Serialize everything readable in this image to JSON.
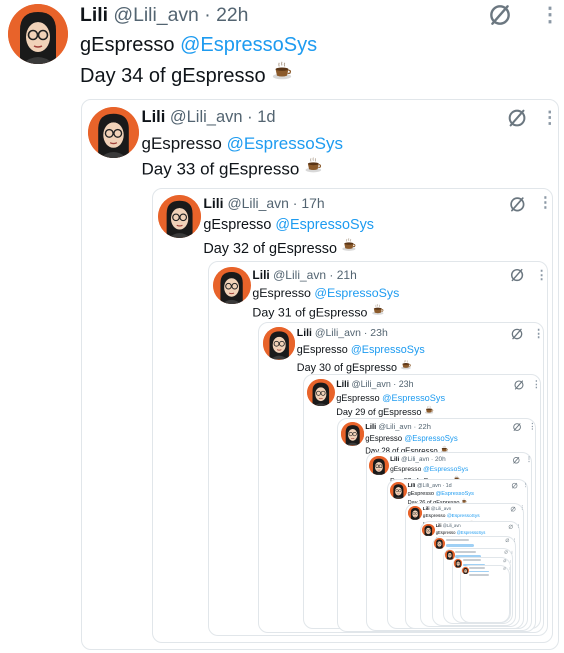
{
  "accent_color": "#1d9bf0",
  "avatar_colors": {
    "background": "#e8632a",
    "hair": "#1a1a1a",
    "skin": "#f1d2b8"
  },
  "tweets": [
    {
      "name": "Lili",
      "handle": "@Lili_avn",
      "time": "22h",
      "text": "gEspresso",
      "mention": "@EspressoSys",
      "caption": "Day 34 of gEspresso"
    },
    {
      "name": "Lili",
      "handle": "@Lili_avn",
      "time": "1d",
      "text": "gEspresso",
      "mention": "@EspressoSys",
      "caption": "Day 33 of gEspresso"
    },
    {
      "name": "Lili",
      "handle": "@Lili_avn",
      "time": "17h",
      "text": "gEspresso",
      "mention": "@EspressoSys",
      "caption": "Day 32 of gEspresso"
    },
    {
      "name": "Lili",
      "handle": "@Lili_avn",
      "time": "21h",
      "text": "gEspresso",
      "mention": "@EspressoSys",
      "caption": "Day 31 of gEspresso"
    },
    {
      "name": "Lili",
      "handle": "@Lili_avn",
      "time": "23h",
      "text": "gEspresso",
      "mention": "@EspressoSys",
      "caption": "Day 30 of gEspresso"
    },
    {
      "name": "Lili",
      "handle": "@Lili_avn",
      "time": "23h",
      "text": "gEspresso",
      "mention": "@EspressoSys",
      "caption": "Day 29 of gEspresso"
    },
    {
      "name": "Lili",
      "handle": "@Lili_avn",
      "time": "22h",
      "text": "gEspresso",
      "mention": "@EspressoSys",
      "caption": "Day 28 of gEspresso"
    },
    {
      "name": "Lili",
      "handle": "@Lili_avn",
      "time": "20h",
      "text": "gEspresso",
      "mention": "@EspressoSys",
      "caption": "Day 27 of gEspresso"
    },
    {
      "name": "Lili",
      "handle": "@Lili_avn",
      "time": "1d",
      "text": "gEspresso",
      "mention": "@EspressoSys",
      "caption": "Day 26 of gEspresso"
    },
    {
      "name": "Lili",
      "handle": "@Lili_avn",
      "time": "",
      "text": "gEspresso",
      "mention": "@EspressoSys",
      "caption": "Day 25 of gEspresso"
    },
    {
      "name": "Lili",
      "handle": "@Lili_avn",
      "time": "",
      "text": "gEspresso",
      "mention": "@EspressoSys",
      "caption": "Day 24 of gEspresso"
    },
    {
      "name": "",
      "handle": "",
      "time": "",
      "text": "",
      "mention": "",
      "caption": ""
    },
    {
      "name": "",
      "handle": "",
      "time": "",
      "text": "",
      "mention": "",
      "caption": ""
    },
    {
      "name": "",
      "handle": "",
      "time": "",
      "text": "",
      "mention": "",
      "caption": ""
    },
    {
      "name": "",
      "handle": "",
      "time": "",
      "text": "",
      "mention": "",
      "caption": ""
    }
  ],
  "icons": {
    "unmute": "no-entry-icon",
    "more": "more-vertical-icon",
    "coffee": "coffee-cup-icon"
  }
}
